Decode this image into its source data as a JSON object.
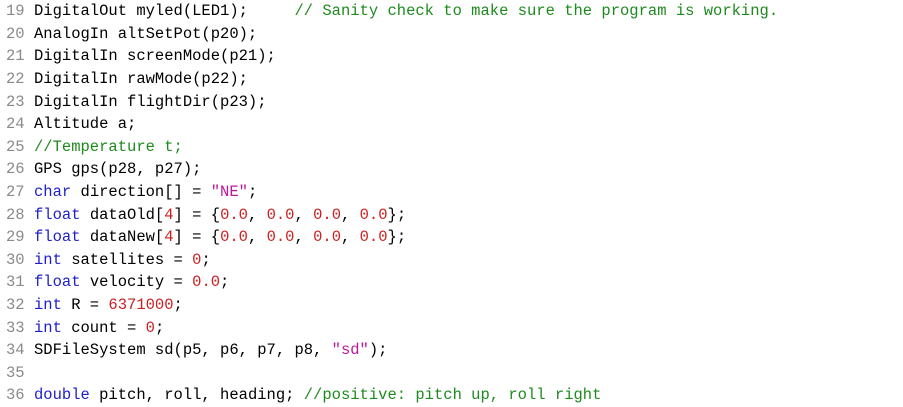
{
  "colors": {
    "keyword": "#1e1ecc",
    "number": "#cc1f1f",
    "string": "#c0179a",
    "comment": "#1e8a1e",
    "gutter": "#8a8a8a",
    "text": "#000000",
    "background": "#ffffff"
  },
  "lines": [
    {
      "num": "19",
      "tokens": [
        {
          "t": "plain",
          "v": "DigitalOut myled(LED1);     "
        },
        {
          "t": "cmt",
          "v": "// Sanity check to make sure the program is working."
        }
      ]
    },
    {
      "num": "20",
      "tokens": [
        {
          "t": "plain",
          "v": "AnalogIn altSetPot(p20);"
        }
      ]
    },
    {
      "num": "21",
      "tokens": [
        {
          "t": "plain",
          "v": "DigitalIn screenMode(p21);"
        }
      ]
    },
    {
      "num": "22",
      "tokens": [
        {
          "t": "plain",
          "v": "DigitalIn rawMode(p22);"
        }
      ]
    },
    {
      "num": "23",
      "tokens": [
        {
          "t": "plain",
          "v": "DigitalIn flightDir(p23);"
        }
      ]
    },
    {
      "num": "24",
      "tokens": [
        {
          "t": "plain",
          "v": "Altitude a;"
        }
      ]
    },
    {
      "num": "25",
      "tokens": [
        {
          "t": "cmt",
          "v": "//Temperature t;"
        }
      ]
    },
    {
      "num": "26",
      "tokens": [
        {
          "t": "plain",
          "v": "GPS gps(p28, p27);"
        }
      ]
    },
    {
      "num": "27",
      "tokens": [
        {
          "t": "type",
          "v": "char"
        },
        {
          "t": "plain",
          "v": " direction[] = "
        },
        {
          "t": "str",
          "v": "\"NE\""
        },
        {
          "t": "plain",
          "v": ";"
        }
      ]
    },
    {
      "num": "28",
      "tokens": [
        {
          "t": "type",
          "v": "float"
        },
        {
          "t": "plain",
          "v": " dataOld["
        },
        {
          "t": "num",
          "v": "4"
        },
        {
          "t": "plain",
          "v": "] = {"
        },
        {
          "t": "num",
          "v": "0.0"
        },
        {
          "t": "plain",
          "v": ", "
        },
        {
          "t": "num",
          "v": "0.0"
        },
        {
          "t": "plain",
          "v": ", "
        },
        {
          "t": "num",
          "v": "0.0"
        },
        {
          "t": "plain",
          "v": ", "
        },
        {
          "t": "num",
          "v": "0.0"
        },
        {
          "t": "plain",
          "v": "};"
        }
      ]
    },
    {
      "num": "29",
      "tokens": [
        {
          "t": "type",
          "v": "float"
        },
        {
          "t": "plain",
          "v": " dataNew["
        },
        {
          "t": "num",
          "v": "4"
        },
        {
          "t": "plain",
          "v": "] = {"
        },
        {
          "t": "num",
          "v": "0.0"
        },
        {
          "t": "plain",
          "v": ", "
        },
        {
          "t": "num",
          "v": "0.0"
        },
        {
          "t": "plain",
          "v": ", "
        },
        {
          "t": "num",
          "v": "0.0"
        },
        {
          "t": "plain",
          "v": ", "
        },
        {
          "t": "num",
          "v": "0.0"
        },
        {
          "t": "plain",
          "v": "};"
        }
      ]
    },
    {
      "num": "30",
      "tokens": [
        {
          "t": "type",
          "v": "int"
        },
        {
          "t": "plain",
          "v": " satellites = "
        },
        {
          "t": "num",
          "v": "0"
        },
        {
          "t": "plain",
          "v": ";"
        }
      ]
    },
    {
      "num": "31",
      "tokens": [
        {
          "t": "type",
          "v": "float"
        },
        {
          "t": "plain",
          "v": " velocity = "
        },
        {
          "t": "num",
          "v": "0.0"
        },
        {
          "t": "plain",
          "v": ";"
        }
      ]
    },
    {
      "num": "32",
      "tokens": [
        {
          "t": "type",
          "v": "int"
        },
        {
          "t": "plain",
          "v": " R = "
        },
        {
          "t": "num",
          "v": "6371000"
        },
        {
          "t": "plain",
          "v": ";"
        }
      ]
    },
    {
      "num": "33",
      "tokens": [
        {
          "t": "type",
          "v": "int"
        },
        {
          "t": "plain",
          "v": " count = "
        },
        {
          "t": "num",
          "v": "0"
        },
        {
          "t": "plain",
          "v": ";"
        }
      ]
    },
    {
      "num": "34",
      "tokens": [
        {
          "t": "plain",
          "v": "SDFileSystem sd(p5, p6, p7, p8, "
        },
        {
          "t": "str",
          "v": "\"sd\""
        },
        {
          "t": "plain",
          "v": ");"
        }
      ]
    },
    {
      "num": "35",
      "tokens": []
    },
    {
      "num": "36",
      "tokens": [
        {
          "t": "type",
          "v": "double"
        },
        {
          "t": "plain",
          "v": " pitch, roll, heading; "
        },
        {
          "t": "cmt",
          "v": "//positive: pitch up, roll right"
        }
      ]
    }
  ]
}
